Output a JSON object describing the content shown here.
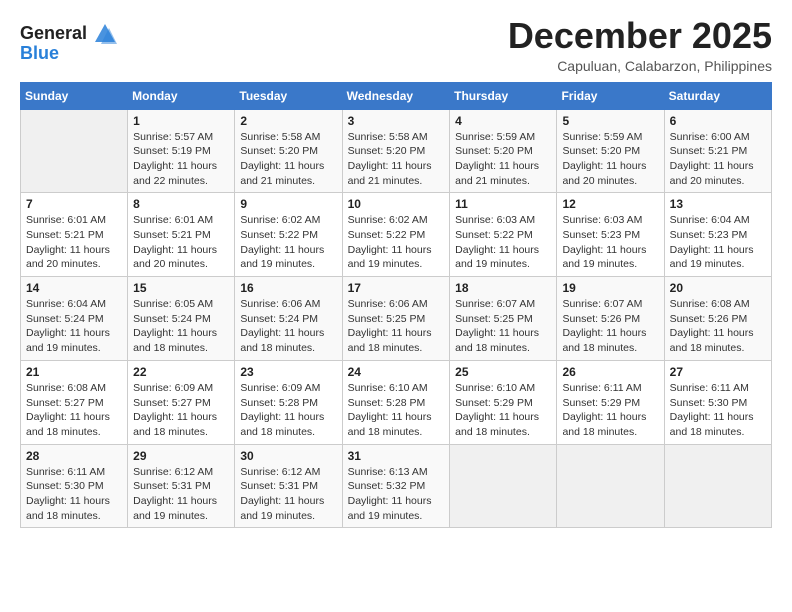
{
  "header": {
    "logo_line1": "General",
    "logo_line2": "Blue",
    "month_title": "December 2025",
    "location": "Capuluan, Calabarzon, Philippines"
  },
  "weekdays": [
    "Sunday",
    "Monday",
    "Tuesday",
    "Wednesday",
    "Thursday",
    "Friday",
    "Saturday"
  ],
  "weeks": [
    [
      {
        "day": "",
        "info": ""
      },
      {
        "day": "1",
        "info": "Sunrise: 5:57 AM\nSunset: 5:19 PM\nDaylight: 11 hours\nand 22 minutes."
      },
      {
        "day": "2",
        "info": "Sunrise: 5:58 AM\nSunset: 5:20 PM\nDaylight: 11 hours\nand 21 minutes."
      },
      {
        "day": "3",
        "info": "Sunrise: 5:58 AM\nSunset: 5:20 PM\nDaylight: 11 hours\nand 21 minutes."
      },
      {
        "day": "4",
        "info": "Sunrise: 5:59 AM\nSunset: 5:20 PM\nDaylight: 11 hours\nand 21 minutes."
      },
      {
        "day": "5",
        "info": "Sunrise: 5:59 AM\nSunset: 5:20 PM\nDaylight: 11 hours\nand 20 minutes."
      },
      {
        "day": "6",
        "info": "Sunrise: 6:00 AM\nSunset: 5:21 PM\nDaylight: 11 hours\nand 20 minutes."
      }
    ],
    [
      {
        "day": "7",
        "info": "Sunrise: 6:01 AM\nSunset: 5:21 PM\nDaylight: 11 hours\nand 20 minutes."
      },
      {
        "day": "8",
        "info": "Sunrise: 6:01 AM\nSunset: 5:21 PM\nDaylight: 11 hours\nand 20 minutes."
      },
      {
        "day": "9",
        "info": "Sunrise: 6:02 AM\nSunset: 5:22 PM\nDaylight: 11 hours\nand 19 minutes."
      },
      {
        "day": "10",
        "info": "Sunrise: 6:02 AM\nSunset: 5:22 PM\nDaylight: 11 hours\nand 19 minutes."
      },
      {
        "day": "11",
        "info": "Sunrise: 6:03 AM\nSunset: 5:22 PM\nDaylight: 11 hours\nand 19 minutes."
      },
      {
        "day": "12",
        "info": "Sunrise: 6:03 AM\nSunset: 5:23 PM\nDaylight: 11 hours\nand 19 minutes."
      },
      {
        "day": "13",
        "info": "Sunrise: 6:04 AM\nSunset: 5:23 PM\nDaylight: 11 hours\nand 19 minutes."
      }
    ],
    [
      {
        "day": "14",
        "info": "Sunrise: 6:04 AM\nSunset: 5:24 PM\nDaylight: 11 hours\nand 19 minutes."
      },
      {
        "day": "15",
        "info": "Sunrise: 6:05 AM\nSunset: 5:24 PM\nDaylight: 11 hours\nand 18 minutes."
      },
      {
        "day": "16",
        "info": "Sunrise: 6:06 AM\nSunset: 5:24 PM\nDaylight: 11 hours\nand 18 minutes."
      },
      {
        "day": "17",
        "info": "Sunrise: 6:06 AM\nSunset: 5:25 PM\nDaylight: 11 hours\nand 18 minutes."
      },
      {
        "day": "18",
        "info": "Sunrise: 6:07 AM\nSunset: 5:25 PM\nDaylight: 11 hours\nand 18 minutes."
      },
      {
        "day": "19",
        "info": "Sunrise: 6:07 AM\nSunset: 5:26 PM\nDaylight: 11 hours\nand 18 minutes."
      },
      {
        "day": "20",
        "info": "Sunrise: 6:08 AM\nSunset: 5:26 PM\nDaylight: 11 hours\nand 18 minutes."
      }
    ],
    [
      {
        "day": "21",
        "info": "Sunrise: 6:08 AM\nSunset: 5:27 PM\nDaylight: 11 hours\nand 18 minutes."
      },
      {
        "day": "22",
        "info": "Sunrise: 6:09 AM\nSunset: 5:27 PM\nDaylight: 11 hours\nand 18 minutes."
      },
      {
        "day": "23",
        "info": "Sunrise: 6:09 AM\nSunset: 5:28 PM\nDaylight: 11 hours\nand 18 minutes."
      },
      {
        "day": "24",
        "info": "Sunrise: 6:10 AM\nSunset: 5:28 PM\nDaylight: 11 hours\nand 18 minutes."
      },
      {
        "day": "25",
        "info": "Sunrise: 6:10 AM\nSunset: 5:29 PM\nDaylight: 11 hours\nand 18 minutes."
      },
      {
        "day": "26",
        "info": "Sunrise: 6:11 AM\nSunset: 5:29 PM\nDaylight: 11 hours\nand 18 minutes."
      },
      {
        "day": "27",
        "info": "Sunrise: 6:11 AM\nSunset: 5:30 PM\nDaylight: 11 hours\nand 18 minutes."
      }
    ],
    [
      {
        "day": "28",
        "info": "Sunrise: 6:11 AM\nSunset: 5:30 PM\nDaylight: 11 hours\nand 18 minutes."
      },
      {
        "day": "29",
        "info": "Sunrise: 6:12 AM\nSunset: 5:31 PM\nDaylight: 11 hours\nand 19 minutes."
      },
      {
        "day": "30",
        "info": "Sunrise: 6:12 AM\nSunset: 5:31 PM\nDaylight: 11 hours\nand 19 minutes."
      },
      {
        "day": "31",
        "info": "Sunrise: 6:13 AM\nSunset: 5:32 PM\nDaylight: 11 hours\nand 19 minutes."
      },
      {
        "day": "",
        "info": ""
      },
      {
        "day": "",
        "info": ""
      },
      {
        "day": "",
        "info": ""
      }
    ]
  ]
}
